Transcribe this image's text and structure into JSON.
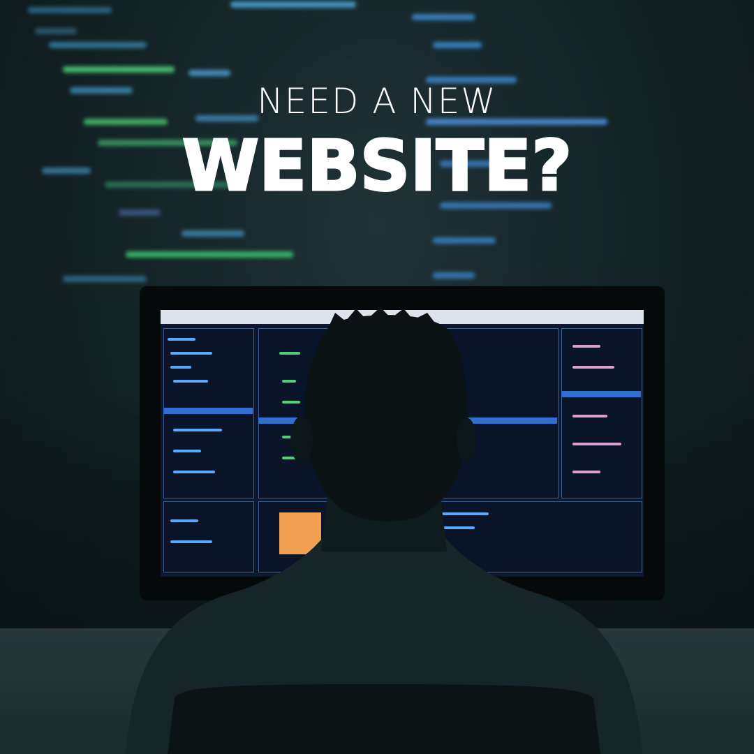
{
  "headline": {
    "line1": "NEED A NEW",
    "line2": "WEBSITE?"
  },
  "colors": {
    "text": "#ffffff",
    "background": "#142427",
    "code_green": "#4fd17a",
    "code_blue": "#5aa8ff",
    "screen_highlight": "#2f6fd1",
    "screen_orange": "#f0a050"
  }
}
